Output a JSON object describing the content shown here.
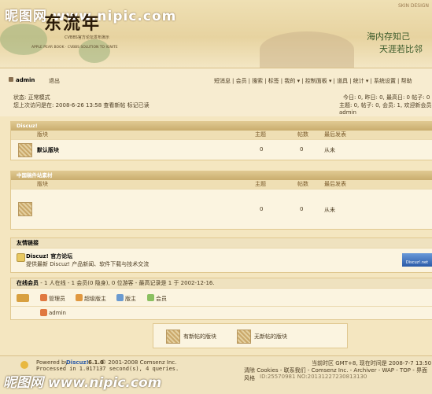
{
  "header": {
    "watermark": "昵图网 www.nipic.com",
    "logo": "东流年",
    "tagline_cn": "CVBBS官方论坛发布演示",
    "tagline_en": "APPLE PEAR BOOK · CVBBS SOLUTION TO IGNITE",
    "skin": "SKIN DESIGN",
    "poem_line1": "海内存知己",
    "poem_line2": "天涯若比邻"
  },
  "nav": {
    "username": "admin",
    "logout": "退出",
    "menu": [
      "短消息",
      "会员",
      "搜索",
      "标签",
      "我的 ▾",
      "控制面板 ▾",
      "道具",
      "统计 ▾",
      "系统设置",
      "帮助"
    ]
  },
  "status": {
    "mode": "状态: 正常模式",
    "last_visit": "您上次访问是在: 2008-6-26 13:58 查看新帖  标记已读",
    "today": "今日: 0, 昨日: 0, 最高日: 0   帖子: 0",
    "stats": "主题: 0, 帖子: 0, 会员: 1, 欢迎新会员 admin"
  },
  "cat1": {
    "name": "Discuz!",
    "col_forum": "版块",
    "col_threads": "主题",
    "col_posts": "帖数",
    "col_last": "最后发表",
    "forum_name": "默认版块",
    "threads": "0",
    "posts": "0",
    "last": "从未"
  },
  "cat2": {
    "name": "中国稿件站素材",
    "col_forum": "版块",
    "col_threads": "主题",
    "col_posts": "帖数",
    "col_last": "最后发表",
    "threads": "0",
    "posts": "0",
    "last": "从未"
  },
  "links": {
    "title": "友情链接",
    "site_name": "Discuz! 官方论坛",
    "site_desc": "提供最新 Discuz! 产品新闻、软件下载与技术交流",
    "banner": "Discuz!.net"
  },
  "online": {
    "title": "在线会员",
    "summary": " - 1 人在线 - 1 会员(0 隐身), 0 位游客 - 最高记录是 1 于 2002-12-16.",
    "legend": [
      "管理员",
      "超级版主",
      "版主",
      "会员"
    ],
    "user": "admin"
  },
  "legendbox": {
    "new_posts": "有新帖的版块",
    "no_new_posts": "无新帖的版块"
  },
  "footer": {
    "powered": "Powered by",
    "product": "Discuz!",
    "version": "6.1.0",
    "copyright": "© 2001-2008 Comsenz Inc.",
    "processed": "Processed in 1.017137 second(s), 4 queries.",
    "timezone": "当前时区 GMT+8, 现在时间是 2008-7-7 13:50",
    "links": "清除 Cookies - 联系我们 - Comsenz Inc. - Archiver - WAP - TOP - 界面风格",
    "watermark_id": "ID:25570981 NO:20131227230813130"
  },
  "colors": {
    "accent": "#c9ad6e",
    "background": "#f4e6c0",
    "text": "#4a3a20"
  }
}
